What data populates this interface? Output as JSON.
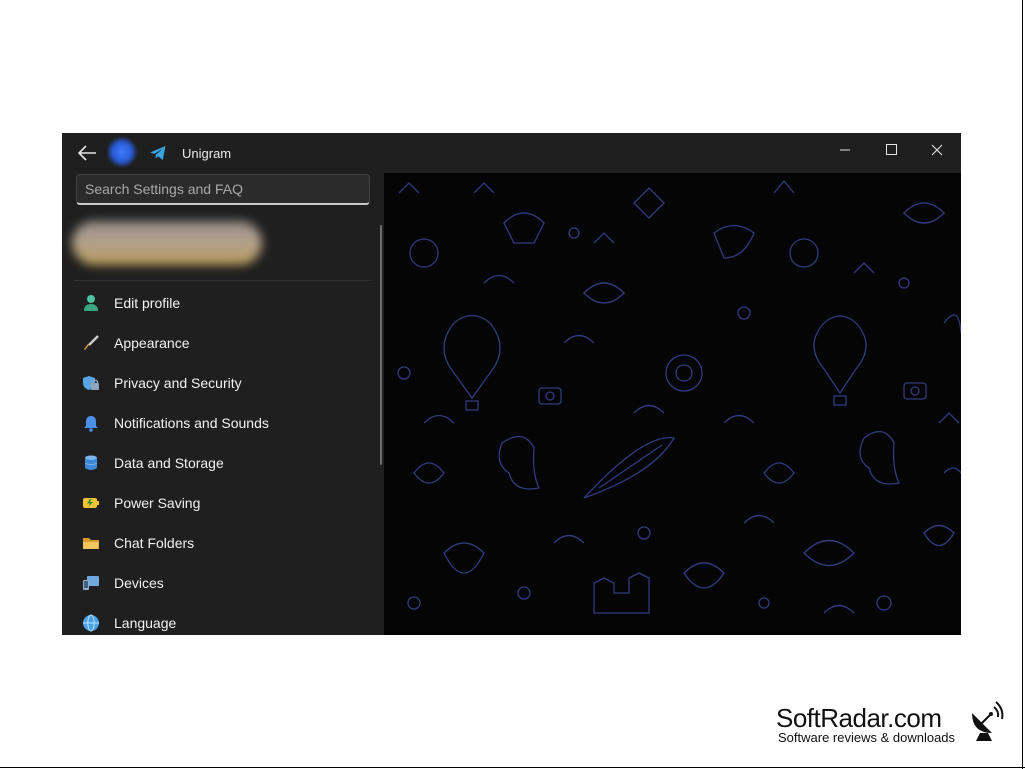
{
  "titlebar": {
    "app_title": "Unigram",
    "back_icon": "arrow-left-icon",
    "app_icon": "telegram-plane-icon",
    "controls": [
      "minimize-icon",
      "maximize-icon",
      "close-icon"
    ]
  },
  "search": {
    "placeholder": "Search Settings and FAQ",
    "value": ""
  },
  "menu": {
    "items": [
      {
        "label": "Edit profile",
        "icon": "person-icon",
        "color": "#4fc3a1"
      },
      {
        "label": "Appearance",
        "icon": "paintbrush-icon",
        "color": "#e8a04a"
      },
      {
        "label": "Privacy and Security",
        "icon": "lock-shield-icon",
        "color": "#5aa4e8"
      },
      {
        "label": "Notifications and Sounds",
        "icon": "bell-icon",
        "color": "#4c8fe8"
      },
      {
        "label": "Data and Storage",
        "icon": "database-icon",
        "color": "#5aa4e8"
      },
      {
        "label": "Power Saving",
        "icon": "battery-icon",
        "color": "#f2c230"
      },
      {
        "label": "Chat Folders",
        "icon": "folder-icon",
        "color": "#f2b94a"
      },
      {
        "label": "Devices",
        "icon": "devices-icon",
        "color": "#6fa8dc"
      },
      {
        "label": "Language",
        "icon": "globe-icon",
        "color": "#4aa3e8"
      }
    ]
  },
  "watermark": {
    "name": "SoftRadar.com",
    "tagline": "Software reviews & downloads",
    "icon": "satellite-dish-icon"
  }
}
